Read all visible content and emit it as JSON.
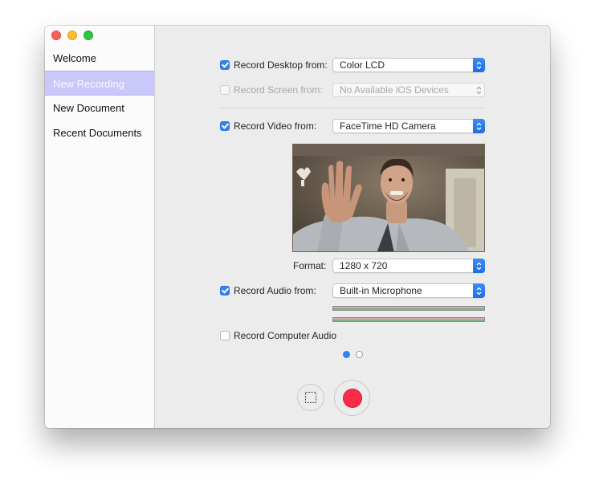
{
  "sidebar": {
    "items": [
      {
        "label": "Welcome"
      },
      {
        "label": "New Recording"
      },
      {
        "label": "New Document"
      },
      {
        "label": "Recent Documents"
      }
    ]
  },
  "desktop": {
    "label": "Record Desktop from:",
    "checked": true,
    "value": "Color LCD"
  },
  "screen": {
    "label": "Record Screen from:",
    "checked": false,
    "value": "No Available iOS Devices"
  },
  "video": {
    "label": "Record Video from:",
    "checked": true,
    "value": "FaceTime HD Camera"
  },
  "format": {
    "label": "Format:",
    "value": "1280 x 720"
  },
  "audio": {
    "label": "Record Audio from:",
    "checked": true,
    "value": "Built-in Microphone"
  },
  "computer_audio": {
    "label": "Record Computer Audio",
    "checked": false
  },
  "pager": {
    "pages": 2,
    "active": 1
  },
  "colors": {
    "accent": "#2f82f0",
    "record": "#fd2c46",
    "selection": "#cac8fb"
  },
  "icons": {
    "select_area": "dashed-rectangle-icon",
    "record": "record-dot-icon"
  }
}
